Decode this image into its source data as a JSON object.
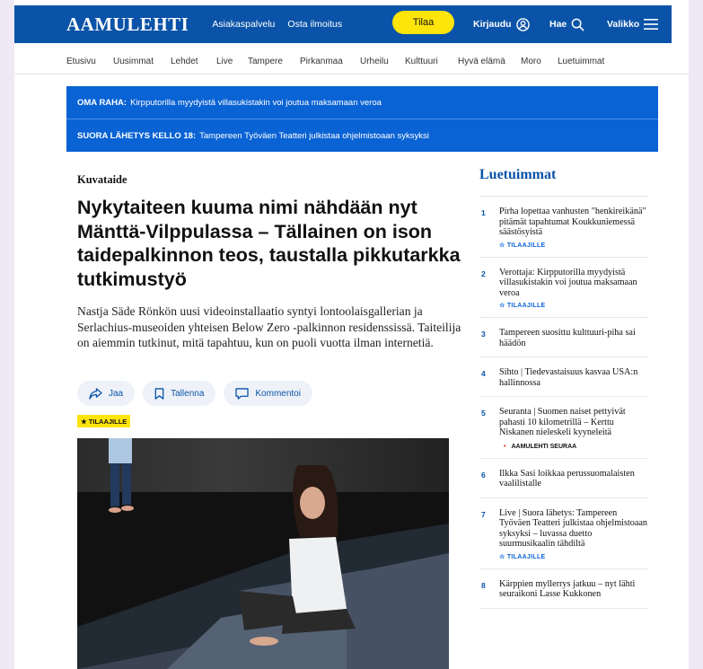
{
  "header": {
    "logo": "AAMULEHTI",
    "links": [
      "Asiakaspalvelu",
      "Osta ilmoitus"
    ],
    "subscribe_label": "Tilaa",
    "login_label": "Kirjaudu",
    "search_label": "Hae",
    "menu_label": "Valikko",
    "colors": {
      "brand": "#0a53a8",
      "subscribe": "#fde40a"
    }
  },
  "nav": {
    "items": [
      "Etusivu",
      "Uusimmat",
      "Lehdet",
      "Live",
      "Tampere",
      "Pirkanmaa",
      "Urheilu",
      "Kulttuuri",
      "Hyvä elämä",
      "Moro",
      "Luetuimmat"
    ]
  },
  "alerts": [
    {
      "label": "OMA RAHA:",
      "text": "Kirpputorilla myydyistä villasukistakin voi joutua maksamaan veroa"
    },
    {
      "label": "SUORA LÄHETYS KELLO 18:",
      "text": "Tampereen Työväen Teatteri julkistaa ohjelmistoaan syksyksi"
    }
  ],
  "article": {
    "kicker": "Kuvataide",
    "headline": "Nykytaiteen kuuma nimi nähdään nyt Mänttä-Vilppulassa – Tällainen on ison taidepalkinnon teos, taustalla pikkutarkka tutkimustyö",
    "lead": "Nastja Säde Rönkön uusi videoinstallaatio syntyi lontoolaisgallerian ja Serlachius-museoiden yhteisen Below Zero -palkinnon residenssissä. Taiteilija on aiemmin tutkinut, mitä tapahtuu, kun on puoli vuotta ilman internetiä.",
    "actions": {
      "share": "Jaa",
      "save": "Tallenna",
      "comment": "Kommentoi"
    },
    "badge": "★ TILAAJILLE"
  },
  "sidebar": {
    "title": "Luetuimmat",
    "items": [
      {
        "num": "1",
        "text": "Pirha lopettaa vanhusten \"henkireikänä\" pitämät tapahtumat Koukkuniemessä säästösyistä",
        "tag": "☆ TILAAJILLE"
      },
      {
        "num": "2",
        "text": "Verottaja: Kirpputorilla myydyistä villasukistakin voi joutua maksamaan veroa",
        "tag": "☆ TILAAJILLE"
      },
      {
        "num": "3",
        "text": "Tampereen suosittu kulttuuri-piha sai häädön",
        "tag": ""
      },
      {
        "num": "4",
        "text": "Sihto | Tiedevastaisuus kasvaa USA:n hallinnossa",
        "tag": ""
      },
      {
        "num": "5",
        "text": "Seuranta | Suomen naiset pettyivät pahasti 10 kilometrillä – Kerttu Niskanen nieleskeli kyyneleitä",
        "seura": "AAMULEHTI SEURAA"
      },
      {
        "num": "6",
        "text": "Ilkka Sasi loikkaa perussuomalaisten vaalilistalle",
        "tag": ""
      },
      {
        "num": "7",
        "text": "Live | Suora lähetys: Tampereen Työväen Teatteri julkistaa ohjelmistoaan syksyksi – luvassa duetto suurmusikaalin tähdiltä",
        "tag": "☆ TILAAJILLE"
      },
      {
        "num": "8",
        "text": "Kärppien myllerrys jatkuu – nyt lähti seuraikoni Lasse Kukkonen",
        "tag": ""
      }
    ]
  }
}
